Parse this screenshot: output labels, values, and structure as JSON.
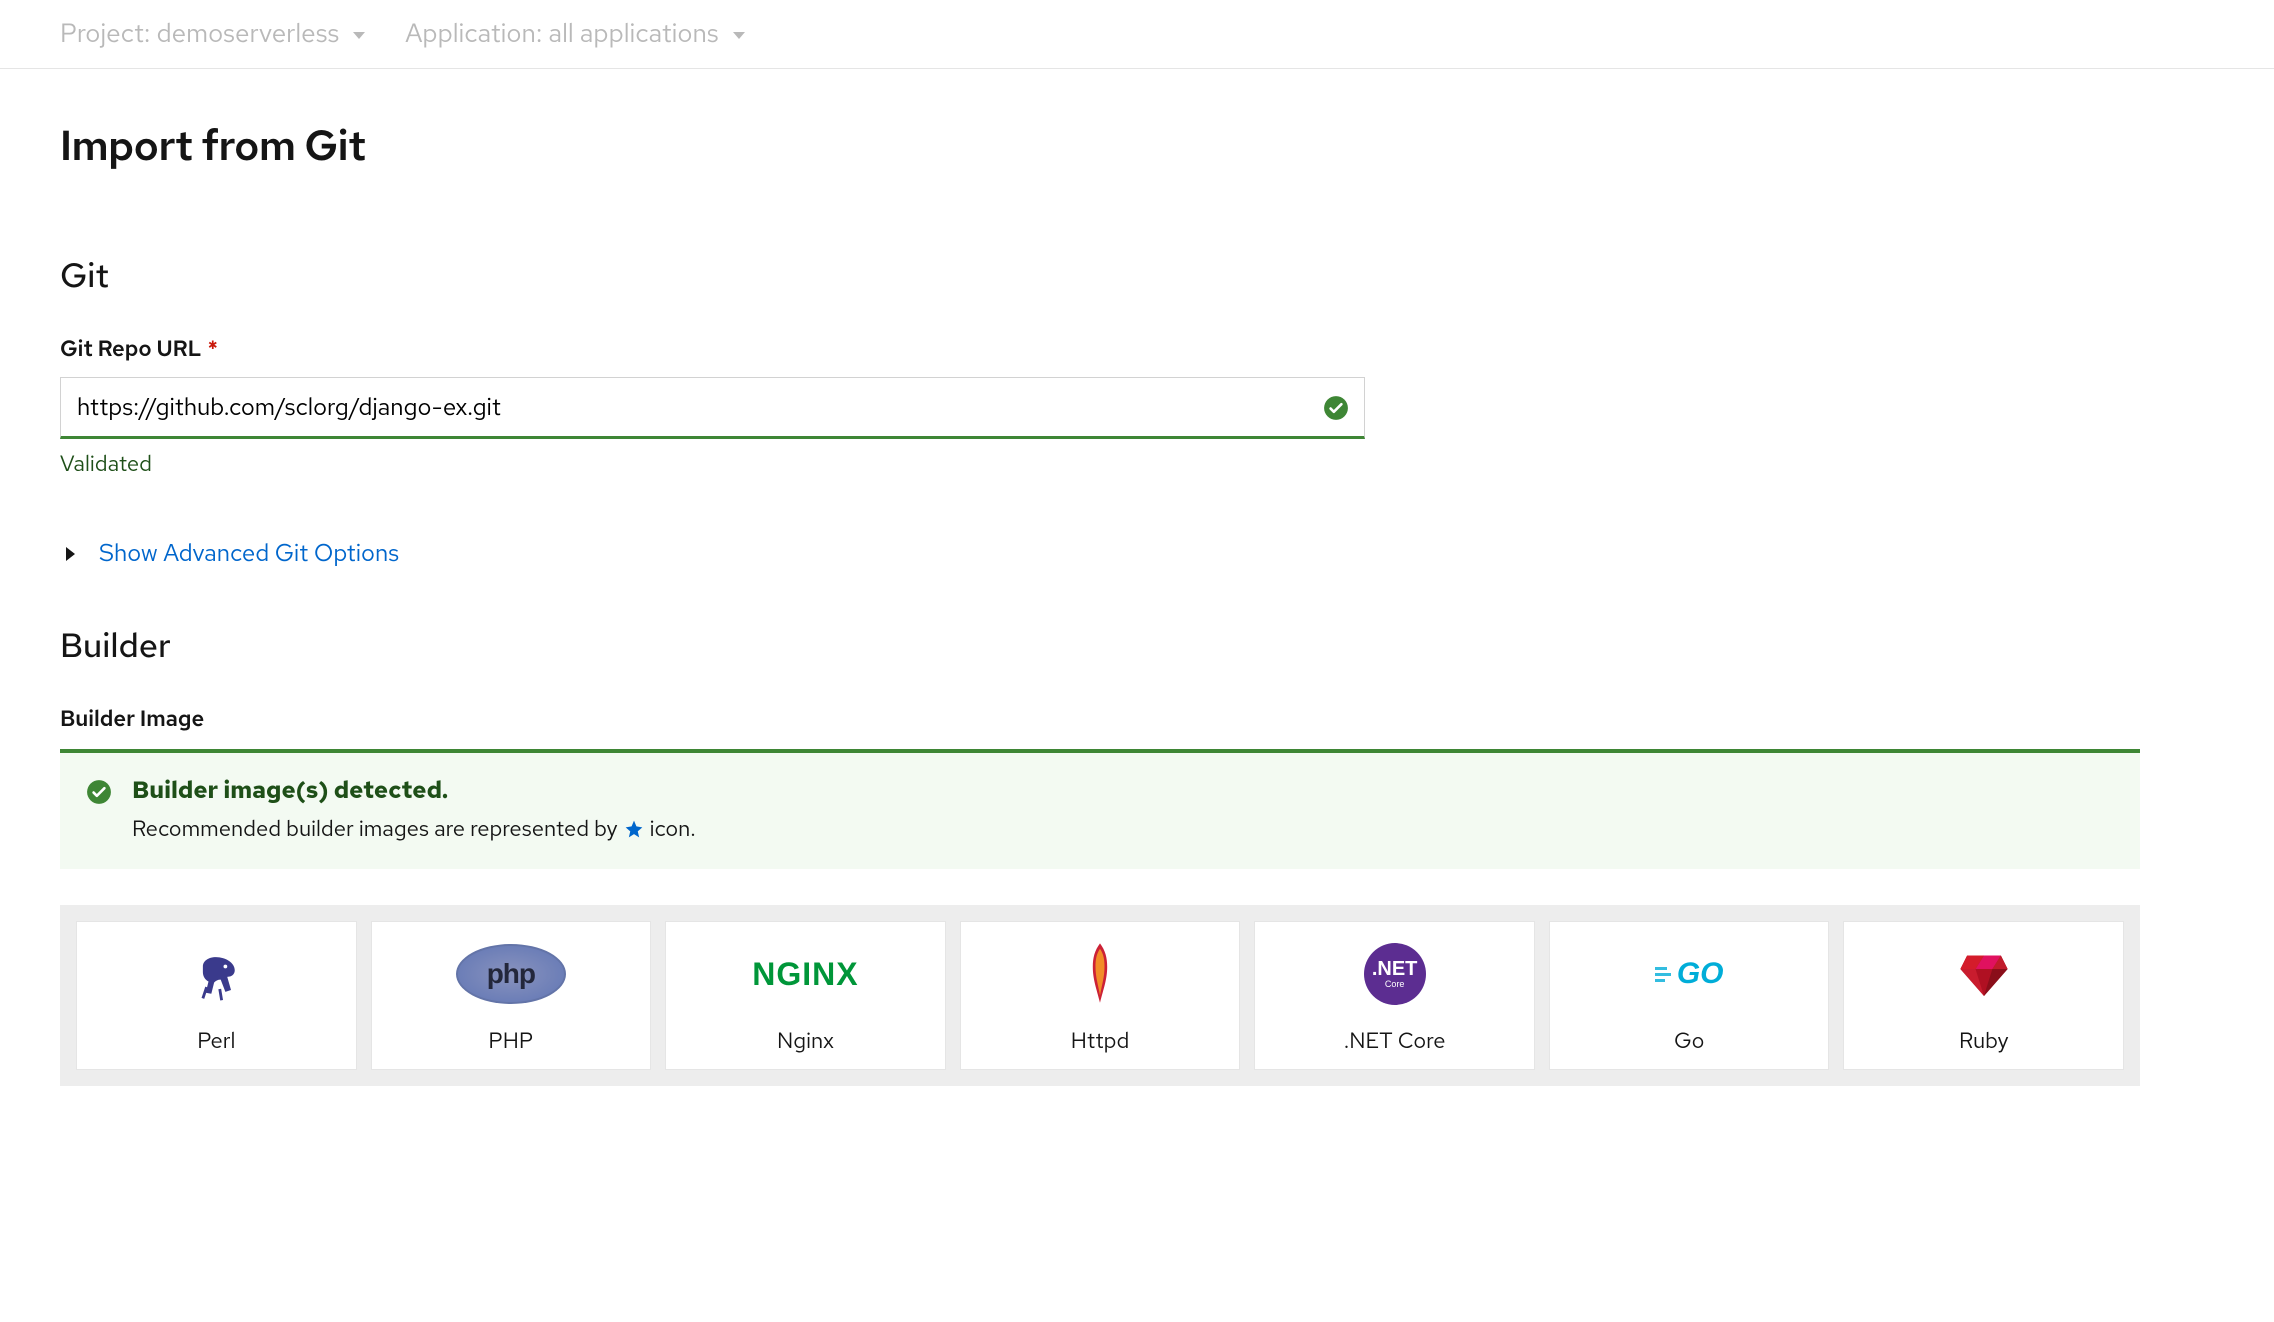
{
  "topbar": {
    "project_dropdown": "Project: demoserverless",
    "application_dropdown": "Application: all applications"
  },
  "page": {
    "title": "Import from Git"
  },
  "git": {
    "section_title": "Git",
    "url_label": "Git Repo URL",
    "url_value": "https://github.com/sclorg/django-ex.git",
    "validated_text": "Validated",
    "advanced_link": "Show Advanced Git Options"
  },
  "builder": {
    "section_title": "Builder",
    "image_label": "Builder Image",
    "alert_title": "Builder image(s) detected.",
    "alert_desc_pre": "Recommended builder images are represented by",
    "alert_desc_post": "icon.",
    "items": [
      {
        "label": "Perl"
      },
      {
        "label": "PHP"
      },
      {
        "label": "Nginx"
      },
      {
        "label": "Httpd"
      },
      {
        "label": ".NET Core"
      },
      {
        "label": "Go"
      },
      {
        "label": "Ruby"
      }
    ],
    "nginx_logo_text": "NGINX",
    "php_logo_text": "php",
    "go_logo_text": "GO",
    "dotnet_top": ".NET",
    "dotnet_bot": "Core"
  }
}
